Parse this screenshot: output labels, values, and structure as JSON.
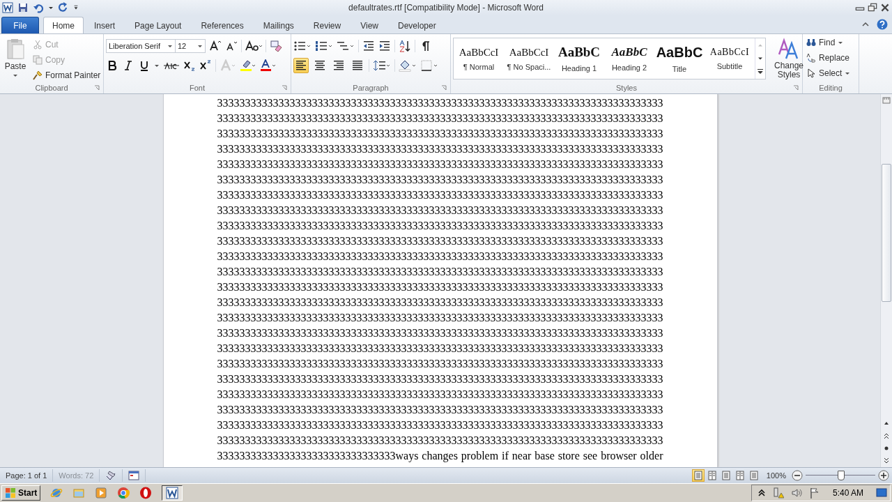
{
  "window": {
    "title": "defaultrates.rtf [Compatibility Mode]  -  Microsoft Word"
  },
  "tabs": [
    {
      "label": "File",
      "kind": "file",
      "selected": false
    },
    {
      "label": "Home",
      "kind": "tab",
      "selected": true
    },
    {
      "label": "Insert",
      "kind": "tab",
      "selected": false
    },
    {
      "label": "Page Layout",
      "kind": "tab",
      "selected": false
    },
    {
      "label": "References",
      "kind": "tab",
      "selected": false
    },
    {
      "label": "Mailings",
      "kind": "tab",
      "selected": false
    },
    {
      "label": "Review",
      "kind": "tab",
      "selected": false
    },
    {
      "label": "View",
      "kind": "tab",
      "selected": false
    },
    {
      "label": "Developer",
      "kind": "tab",
      "selected": false
    }
  ],
  "clipboard": {
    "label": "Clipboard",
    "paste": "Paste",
    "cut": {
      "label": "Cut",
      "disabled": true
    },
    "copy": {
      "label": "Copy",
      "disabled": true
    },
    "format_painter": {
      "label": "Format Painter",
      "disabled": false
    }
  },
  "font": {
    "label": "Font",
    "family": "Liberation Serif",
    "size": "12"
  },
  "paragraph": {
    "label": "Paragraph",
    "alignments": [
      {
        "kind": "left",
        "selected": true
      },
      {
        "kind": "center",
        "selected": false
      },
      {
        "kind": "right",
        "selected": false
      },
      {
        "kind": "justify",
        "selected": false
      }
    ]
  },
  "styles": {
    "label": "Styles",
    "items": [
      {
        "preview": "AaBbCcI",
        "name": "¶ Normal",
        "kind": "normal",
        "selected": false
      },
      {
        "preview": "AaBbCcI",
        "name": "¶ No Spaci...",
        "kind": "nospacing",
        "selected": false
      },
      {
        "preview": "AaBbC",
        "name": "Heading 1",
        "kind": "heading1",
        "selected": false
      },
      {
        "preview": "AaBbC",
        "name": "Heading 2",
        "kind": "heading2",
        "selected": false
      },
      {
        "preview": "AaBbC",
        "name": "Title",
        "kind": "title",
        "selected": false
      },
      {
        "preview": "AaBbCcI",
        "name": "Subtitle",
        "kind": "subtitle",
        "selected": false
      }
    ],
    "change_styles": "Change Styles"
  },
  "editing": {
    "label": "Editing",
    "find": "Find",
    "replace": "Replace",
    "select": "Select"
  },
  "document": {
    "lines": [
      "33333333333333333333333333333333333333333333333333333333333333333333333333333333",
      "33333333333333333333333333333333333333333333333333333333333333333333333333333333",
      "33333333333333333333333333333333333333333333333333333333333333333333333333333333",
      "33333333333333333333333333333333333333333333333333333333333333333333333333333333",
      "33333333333333333333333333333333333333333333333333333333333333333333333333333333",
      "33333333333333333333333333333333333333333333333333333333333333333333333333333333",
      "33333333333333333333333333333333333333333333333333333333333333333333333333333333",
      "33333333333333333333333333333333333333333333333333333333333333333333333333333333",
      "33333333333333333333333333333333333333333333333333333333333333333333333333333333",
      "33333333333333333333333333333333333333333333333333333333333333333333333333333333",
      "33333333333333333333333333333333333333333333333333333333333333333333333333333333",
      "33333333333333333333333333333333333333333333333333333333333333333333333333333333",
      "33333333333333333333333333333333333333333333333333333333333333333333333333333333",
      "33333333333333333333333333333333333333333333333333333333333333333333333333333333",
      "33333333333333333333333333333333333333333333333333333333333333333333333333333333",
      "33333333333333333333333333333333333333333333333333333333333333333333333333333333",
      "33333333333333333333333333333333333333333333333333333333333333333333333333333333",
      "33333333333333333333333333333333333333333333333333333333333333333333333333333333",
      "33333333333333333333333333333333333333333333333333333333333333333333333333333333",
      "33333333333333333333333333333333333333333333333333333333333333333333333333333333",
      "33333333333333333333333333333333333333333333333333333333333333333333333333333333",
      "33333333333333333333333333333333333333333333333333333333333333333333333333333333",
      "33333333333333333333333333333333333333333333333333333333333333333333333333333333",
      "33333333333333333333333333333333ways changes problem if near base store see browser older"
    ]
  },
  "status_bar": {
    "page": "Page: 1 of 1",
    "words": "Words: 72",
    "views": [
      {
        "selected": true
      },
      {
        "selected": false
      },
      {
        "selected": false
      },
      {
        "selected": false
      },
      {
        "selected": false
      }
    ],
    "zoom": "100%",
    "zoom_slider": {
      "level": 0.5
    }
  },
  "taskbar": {
    "start": "Start",
    "time": "5:40 AM"
  }
}
